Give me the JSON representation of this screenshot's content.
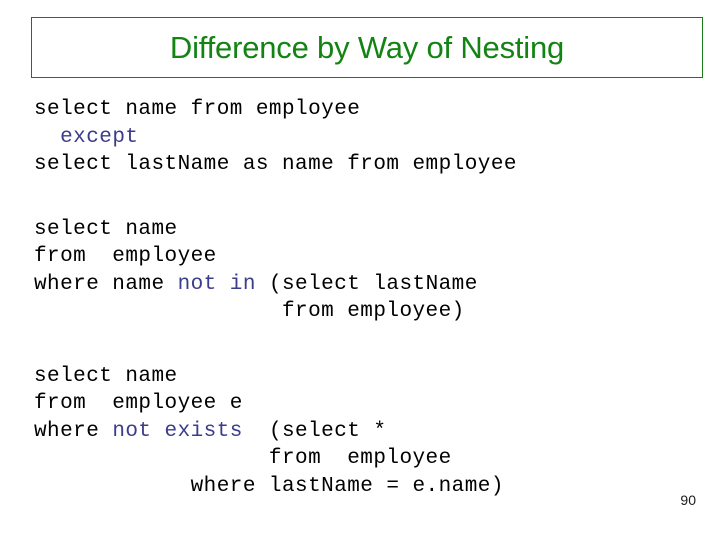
{
  "slide": {
    "title": "Difference by Way of Nesting",
    "title_color": "#138413",
    "border_color": "#1a7a1a",
    "background_color": "#ffffff",
    "keyword_color": "#3c3c8c",
    "code_color": "#000000",
    "page_number": "90"
  },
  "code_blocks": [
    {
      "id": "except-query",
      "lines": [
        {
          "segments": [
            {
              "text": "select name from employee",
              "style": "plain"
            }
          ]
        },
        {
          "segments": [
            {
              "text": "  ",
              "style": "plain"
            },
            {
              "text": "except",
              "style": "keyword"
            }
          ]
        },
        {
          "segments": [
            {
              "text": "select lastName as name from employee",
              "style": "plain"
            }
          ]
        }
      ],
      "plain_text": "select name from employee\n  except\nselect lastName as name from employee"
    },
    {
      "id": "not-in-query",
      "lines": [
        {
          "segments": [
            {
              "text": "select name",
              "style": "plain"
            }
          ]
        },
        {
          "segments": [
            {
              "text": "from  employee",
              "style": "plain"
            }
          ]
        },
        {
          "segments": [
            {
              "text": "where name ",
              "style": "plain"
            },
            {
              "text": "not in",
              "style": "keyword"
            },
            {
              "text": " (select lastName",
              "style": "plain"
            }
          ]
        },
        {
          "segments": [
            {
              "text": "                   from employee)",
              "style": "plain"
            }
          ]
        }
      ],
      "plain_text": "select name\nfrom  employee\nwhere name not in (select lastName\n                   from employee)"
    },
    {
      "id": "not-exists-query",
      "lines": [
        {
          "segments": [
            {
              "text": "select name",
              "style": "plain"
            }
          ]
        },
        {
          "segments": [
            {
              "text": "from  employee e",
              "style": "plain"
            }
          ]
        },
        {
          "segments": [
            {
              "text": "where ",
              "style": "plain"
            },
            {
              "text": "not exists",
              "style": "keyword"
            },
            {
              "text": "  (select *",
              "style": "plain"
            }
          ]
        },
        {
          "segments": [
            {
              "text": "                  from  employee",
              "style": "plain"
            }
          ]
        },
        {
          "segments": [
            {
              "text": "            where lastName = e.name)",
              "style": "plain"
            }
          ]
        }
      ],
      "plain_text": "select name\nfrom  employee e\nwhere not exists  (select *\n                  from  employee\n            where lastName = e.name)"
    }
  ]
}
